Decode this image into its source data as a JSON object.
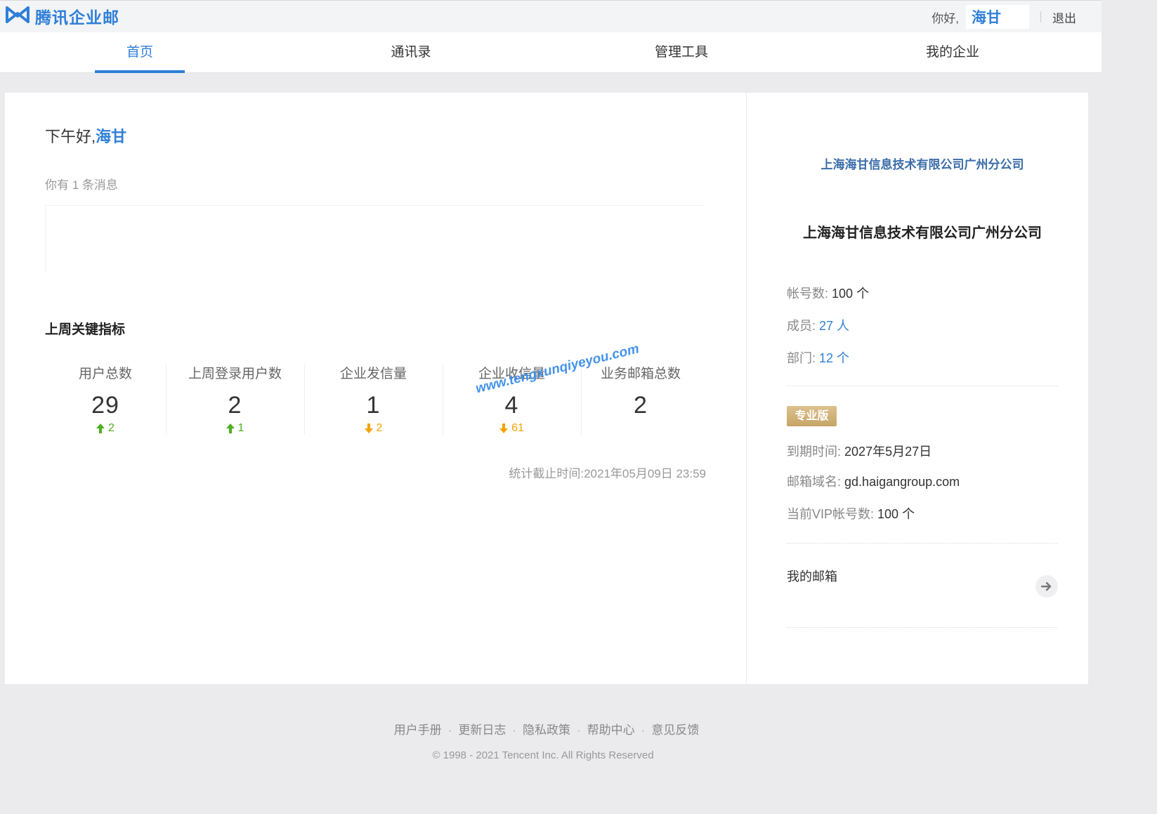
{
  "header": {
    "logo_text": "腾讯企业邮",
    "greeting": "你好,",
    "user_name": "海甘",
    "logout_label": "退出"
  },
  "nav": {
    "tabs": [
      {
        "label": "首页",
        "active": true
      },
      {
        "label": "通讯录",
        "active": false
      },
      {
        "label": "管理工具",
        "active": false
      },
      {
        "label": "我的企业",
        "active": false
      }
    ]
  },
  "main": {
    "hello_prefix": "下午好,",
    "hello_name": "海甘",
    "message_count_text": "你有 1 条消息",
    "kpi_title": "上周关键指标",
    "kpis": [
      {
        "label": "用户总数",
        "value": "29",
        "delta": "2",
        "direction": "up"
      },
      {
        "label": "上周登录用户数",
        "value": "2",
        "delta": "1",
        "direction": "up"
      },
      {
        "label": "企业发信量",
        "value": "1",
        "delta": "2",
        "direction": "down"
      },
      {
        "label": "企业收信量",
        "value": "4",
        "delta": "61",
        "direction": "down"
      },
      {
        "label": "业务邮箱总数",
        "value": "2",
        "delta": "",
        "direction": "none"
      }
    ],
    "stat_time": "统计截止时间:2021年05月09日 23:59",
    "watermark": "www.tengxunqiyeyou.com"
  },
  "company": {
    "logo_text": "上海海甘信息技术有限公司广州分公司",
    "name": "上海海甘信息技术有限公司广州分公司",
    "accounts_label": "帐号数:",
    "accounts_value": "100 个",
    "members_label": "成员:",
    "members_value": "27 人",
    "departments_label": "部门:",
    "departments_value": "12 个",
    "edition_badge": "专业版",
    "expiry_label": "到期时间:",
    "expiry_value": "2027年5月27日",
    "domain_label": "邮箱域名:",
    "domain_value": "gd.haigangroup.com",
    "vip_label": "当前VIP帐号数:",
    "vip_value": "100 个",
    "my_mailbox_label": "我的邮箱"
  },
  "footer": {
    "links": [
      "用户手册",
      "更新日志",
      "隐私政策",
      "帮助中心",
      "意见反馈"
    ],
    "copyright": "© 1998 - 2021 Tencent Inc. All Rights Reserved"
  },
  "colors": {
    "accent": "#2f7fd8",
    "up": "#4caf1f",
    "down": "#f5a300",
    "badge": "#c6a466"
  }
}
